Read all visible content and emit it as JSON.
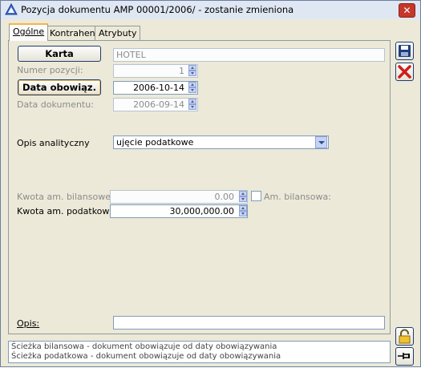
{
  "window": {
    "title": "Pozycja dokumentu AMP 00001/2006/ - zostanie zmieniona",
    "close_label": "✕"
  },
  "tabs": [
    {
      "label": "Ogólne",
      "active": true
    },
    {
      "label": "Kontrahent",
      "active": false
    },
    {
      "label": "Atrybuty",
      "active": false
    }
  ],
  "form": {
    "karta_button": "Karta",
    "karta_value": "HOTEL",
    "numer_pozycji_label": "Numer pozycji:",
    "numer_pozycji_value": "1",
    "data_obowiaz_button": "Data obowiąz.",
    "data_obowiaz_value": "2006-10-14",
    "data_dokumentu_label": "Data dokumentu:",
    "data_dokumentu_value": "2006-09-14",
    "opis_analityczny_label": "Opis analityczny",
    "opis_analityczny_value": "ujęcie podatkowe",
    "kwota_bil_label": "Kwota am. bilansowej:",
    "kwota_bil_value": "0.00",
    "am_bilansowa_label": "Am. bilansowa:",
    "kwota_pod_label": "Kwota am. podatkowej:",
    "kwota_pod_value": "30,000,000.00",
    "opis_label": "Opis:",
    "opis_value": ""
  },
  "status": {
    "line1": "Ścieżka bilansowa - dokument obowiązuje od daty obowiązywania",
    "line2": "Ścieżka podatkowa - dokument obowiązuje od daty obowiązywania"
  },
  "colors": {
    "title_bg": "#dfe7f3",
    "close_red": "#c6372a",
    "window_bg": "#ece9d8",
    "field_border": "#7f9db9"
  }
}
